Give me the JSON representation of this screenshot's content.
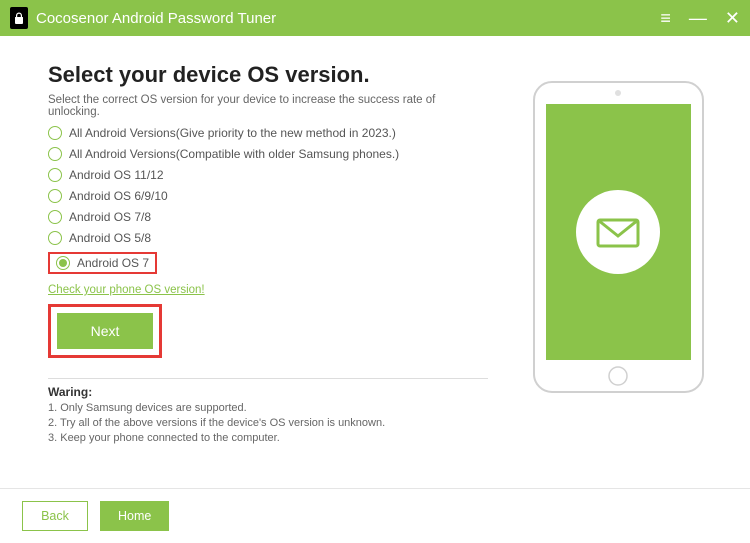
{
  "titlebar": {
    "title": "Cocosenor Android Password Tuner"
  },
  "page": {
    "heading": "Select your device OS version.",
    "subheading": "Select the correct OS version for your device to increase the success rate of unlocking.",
    "check_link": "Check your phone OS version!",
    "next_label": "Next"
  },
  "options": [
    {
      "label": "All Android Versions(Give priority to the new method in 2023.)",
      "selected": false
    },
    {
      "label": "All Android Versions(Compatible with older Samsung phones.)",
      "selected": false
    },
    {
      "label": "Android OS 11/12",
      "selected": false
    },
    {
      "label": "Android OS 6/9/10",
      "selected": false
    },
    {
      "label": "Android OS 7/8",
      "selected": false
    },
    {
      "label": "Android OS 5/8",
      "selected": false
    },
    {
      "label": "Android OS 7",
      "selected": true
    }
  ],
  "warning": {
    "title": "Waring:",
    "items": [
      "1. Only Samsung devices are supported.",
      "2. Try all of the above versions if the device's OS version is unknown.",
      "3. Keep your phone connected to the computer."
    ]
  },
  "footer": {
    "back_label": "Back",
    "home_label": "Home"
  },
  "colors": {
    "accent": "#8bc34a",
    "highlight": "#e53935"
  }
}
